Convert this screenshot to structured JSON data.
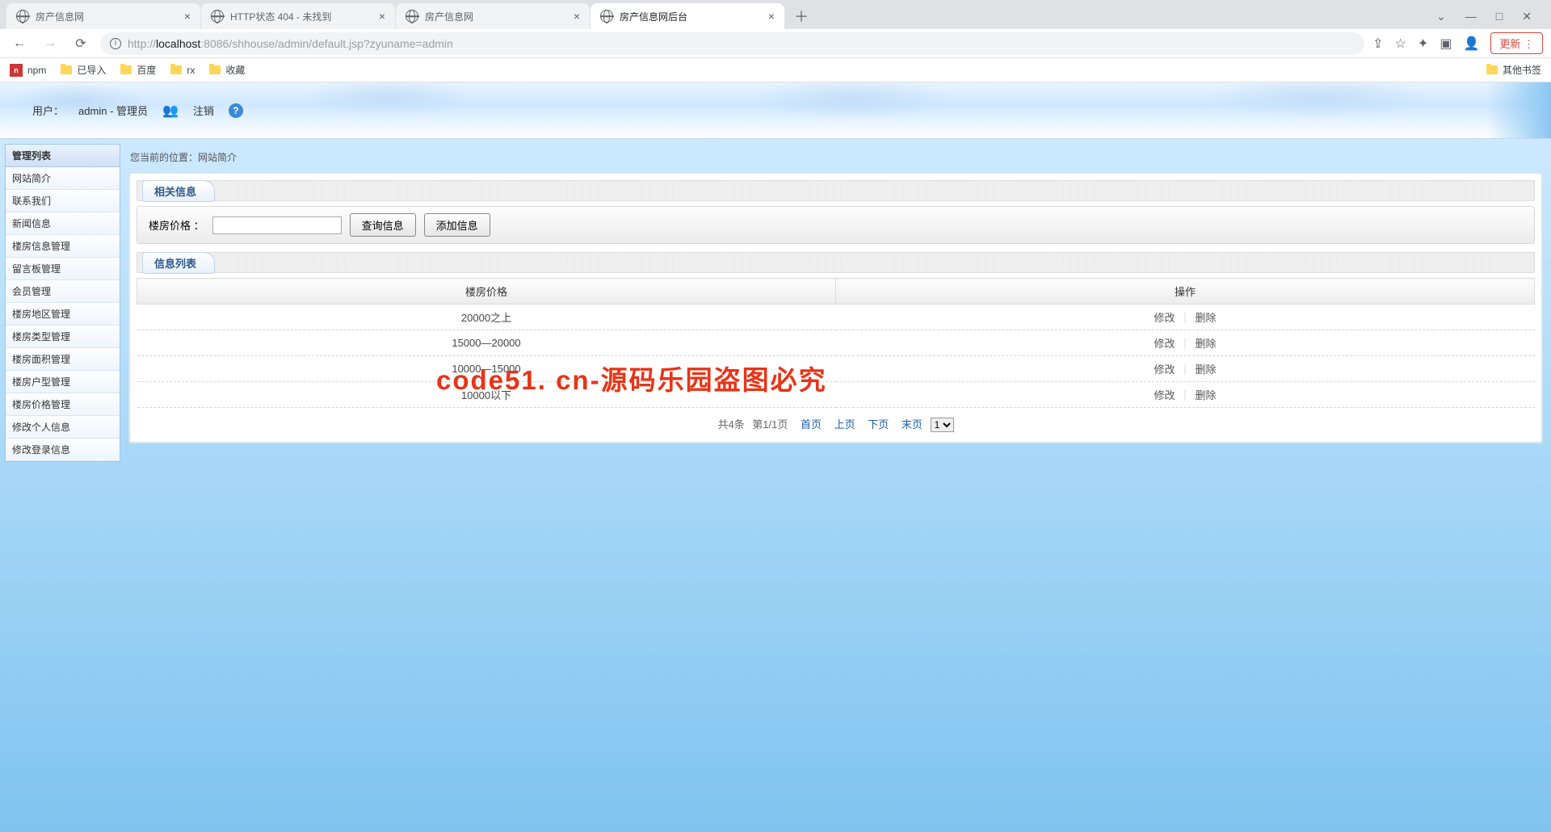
{
  "browser": {
    "tabs": [
      {
        "title": "房产信息网",
        "active": false
      },
      {
        "title": "HTTP状态 404 - 未找到",
        "active": false
      },
      {
        "title": "房产信息网",
        "active": false
      },
      {
        "title": "房产信息网后台",
        "active": true
      }
    ],
    "url_proto": "http://",
    "url_host": "localhost",
    "url_port": ":8086",
    "url_path": "/shhouse/admin/default.jsp?zyuname=admin",
    "update_label": "更新",
    "bookmarks": [
      {
        "label": "npm",
        "icon": "npm"
      },
      {
        "label": "已导入",
        "icon": "folder"
      },
      {
        "label": "百度",
        "icon": "folder"
      },
      {
        "label": "rx",
        "icon": "folder"
      },
      {
        "label": "收藏",
        "icon": "folder"
      }
    ],
    "other_bookmarks": "其他书签"
  },
  "banner": {
    "user_label": "用户：",
    "user_value": "admin - 管理员",
    "logout": "注销"
  },
  "sidebar": {
    "header": "管理列表",
    "items": [
      "网站简介",
      "联系我们",
      "新闻信息",
      "楼房信息管理",
      "留言板管理",
      "会员管理",
      "楼房地区管理",
      "楼房类型管理",
      "楼房面积管理",
      "楼房户型管理",
      "楼房价格管理",
      "修改个人信息",
      "修改登录信息"
    ]
  },
  "breadcrumb": {
    "label": "您当前的位置：",
    "value": "网站简介"
  },
  "section_related": "相关信息",
  "section_list": "信息列表",
  "filter": {
    "label": "楼房价格 ：",
    "btn_query": "查询信息",
    "btn_add": "添加信息"
  },
  "table": {
    "col_price": "楼房价格",
    "col_ops": "操作",
    "op_edit": "修改",
    "op_delete": "删除",
    "rows": [
      {
        "price": "20000之上"
      },
      {
        "price": "15000—20000"
      },
      {
        "price": "10000—15000"
      },
      {
        "price": "10000以下"
      }
    ]
  },
  "pager": {
    "total": "共4条",
    "page": "第1/1页",
    "first": "首页",
    "prev": "上页",
    "next": "下页",
    "last": "末页",
    "select": "1"
  },
  "watermark": "code51. cn-源码乐园盗图必究"
}
